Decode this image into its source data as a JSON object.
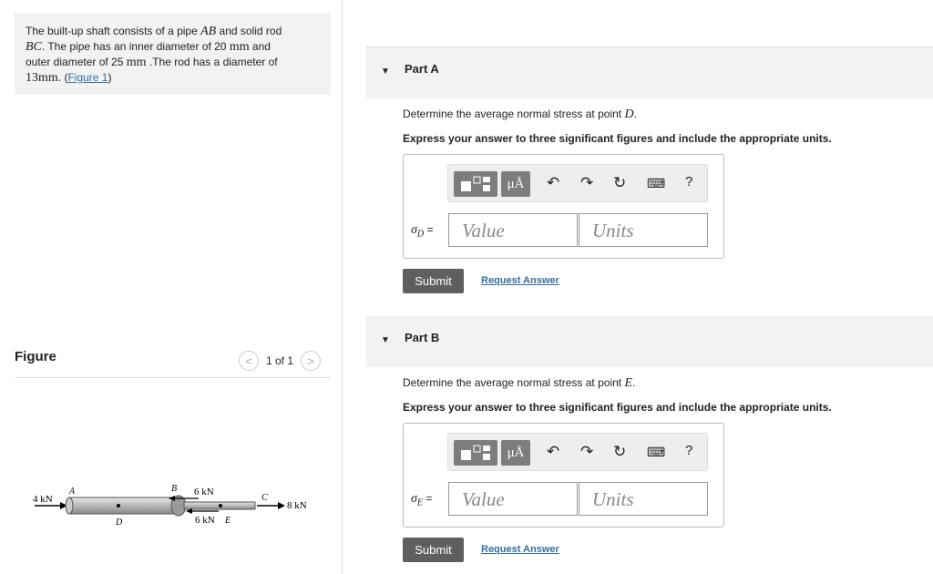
{
  "problem": {
    "t1": "The built-up shaft consists of a pipe ",
    "v1": "AB",
    "t2": " and solid rod",
    "v2": "BC",
    "t3": ". The pipe has an inner diameter of 20 ",
    "u1": "mm",
    "t4": " and",
    "t5": "outer diameter of 25 ",
    "u2": "mm",
    "t6": " .The rod has a diameter of",
    "m1": "13mm",
    "t7": ". (",
    "link": "Figure 1",
    "t8": ")"
  },
  "figure_panel": {
    "title": "Figure",
    "pager_prev": "<",
    "pager_text": "1 of 1",
    "pager_next": ">",
    "labels": {
      "f1": "4 kN",
      "a": "A",
      "d": "D",
      "b": "B",
      "f2": "6 kN",
      "f3": "6 kN",
      "e": "E",
      "c": "C",
      "f4": "8 kN"
    }
  },
  "toolbar": {
    "templates_icon": "templates-icon",
    "units_label": "μÅ",
    "undo_icon": "undo-icon",
    "redo_icon": "redo-icon",
    "reset_icon": "reset-icon",
    "keyboard_icon": "keyboard-icon",
    "help_label": "?"
  },
  "parts": [
    {
      "label": "Part A",
      "prompt": "Determine the average normal stress at point ",
      "point": "D",
      "instruction": "Express your answer to three significant figures and include the appropriate units.",
      "variable": "σ",
      "subscript": "D",
      "equals": "=",
      "value_placeholder": "Value",
      "units_placeholder": "Units",
      "submit": "Submit",
      "request": "Request Answer"
    },
    {
      "label": "Part B",
      "prompt": "Determine the average normal stress at point ",
      "point": "E",
      "instruction": "Express your answer to three significant figures and include the appropriate units.",
      "variable": "σ",
      "subscript": "E",
      "equals": "=",
      "value_placeholder": "Value",
      "units_placeholder": "Units",
      "submit": "Submit",
      "request": "Request Answer"
    }
  ]
}
